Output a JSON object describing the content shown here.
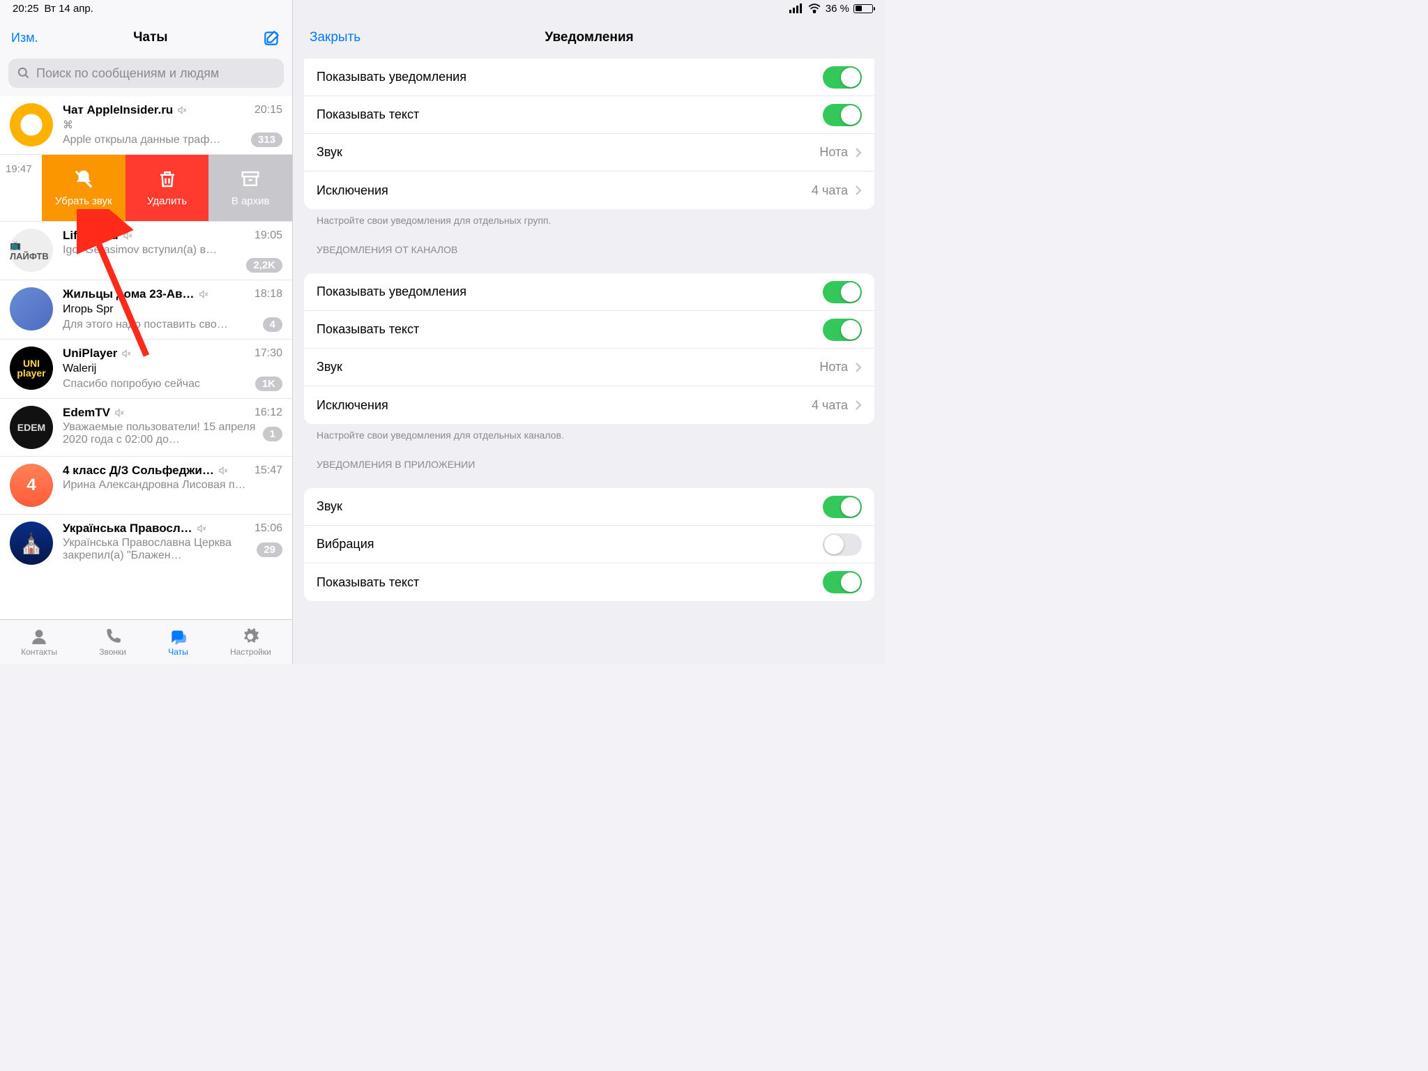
{
  "statusbar": {
    "time": "20:25",
    "date": "Вт 14 апр.",
    "battery": "36 %"
  },
  "left": {
    "edit": "Изм.",
    "title": "Чаты",
    "search_placeholder": "Поиск по сообщениям и людям",
    "swipe": {
      "time": "19:47",
      "mute": "Убрать звук",
      "delete": "Удалить",
      "archive": "В архив"
    },
    "chats": [
      {
        "name": "Чат AppleInsider.ru",
        "time": "20:15",
        "l2": "⌘",
        "l3": "Apple открыла данные траф…",
        "badge": "313"
      },
      {
        "name": "Life TV.eu",
        "time": "19:05",
        "l2": "Igor Gerasimov вступил(а) в…",
        "l3": "",
        "badge": "2,2K"
      },
      {
        "name": "Жильцы дома 23-Ав…",
        "time": "18:18",
        "l2": "Игорь Spr",
        "l3": "Для этого надо поставить сво…",
        "badge": "4"
      },
      {
        "name": "UniPlayer",
        "time": "17:30",
        "l2": "Walerij",
        "l3": "Спасибо попробую сейчас",
        "badge": "1K"
      },
      {
        "name": "EdemTV",
        "time": "16:12",
        "l2": "Уважаемые пользователи! 15 апреля 2020 года с 02:00 до…",
        "l3": "",
        "badge": "1"
      },
      {
        "name": "4 класс Д/З Сольфеджи…",
        "time": "15:47",
        "l2": "Ирина Александровна Лисовая п…",
        "l3": "",
        "badge": ""
      },
      {
        "name": "Українська Правосл…",
        "time": "15:06",
        "l2": "Українська Православна Церква закрепил(а) \"Блажен…",
        "l3": "",
        "badge": "29"
      }
    ],
    "tabs": {
      "contacts": "Контакты",
      "calls": "Звонки",
      "chats": "Чаты",
      "settings": "Настройки"
    }
  },
  "right": {
    "close": "Закрыть",
    "title": "Уведомления",
    "g1": {
      "show_notif": "Показывать уведомления",
      "show_text": "Показывать текст",
      "sound": "Звук",
      "sound_val": "Нота",
      "exceptions": "Исключения",
      "exceptions_val": "4 чата",
      "footer": "Настройте свои уведомления для отдельных групп."
    },
    "g2": {
      "header": "УВЕДОМЛЕНИЯ ОТ КАНАЛОВ",
      "show_notif": "Показывать уведомления",
      "show_text": "Показывать текст",
      "sound": "Звук",
      "sound_val": "Нота",
      "exceptions": "Исключения",
      "exceptions_val": "4 чата",
      "footer": "Настройте свои уведомления для отдельных каналов."
    },
    "g3": {
      "header": "УВЕДОМЛЕНИЯ В ПРИЛОЖЕНИИ",
      "sound": "Звук",
      "vibration": "Вибрация",
      "show_text": "Показывать текст"
    }
  }
}
